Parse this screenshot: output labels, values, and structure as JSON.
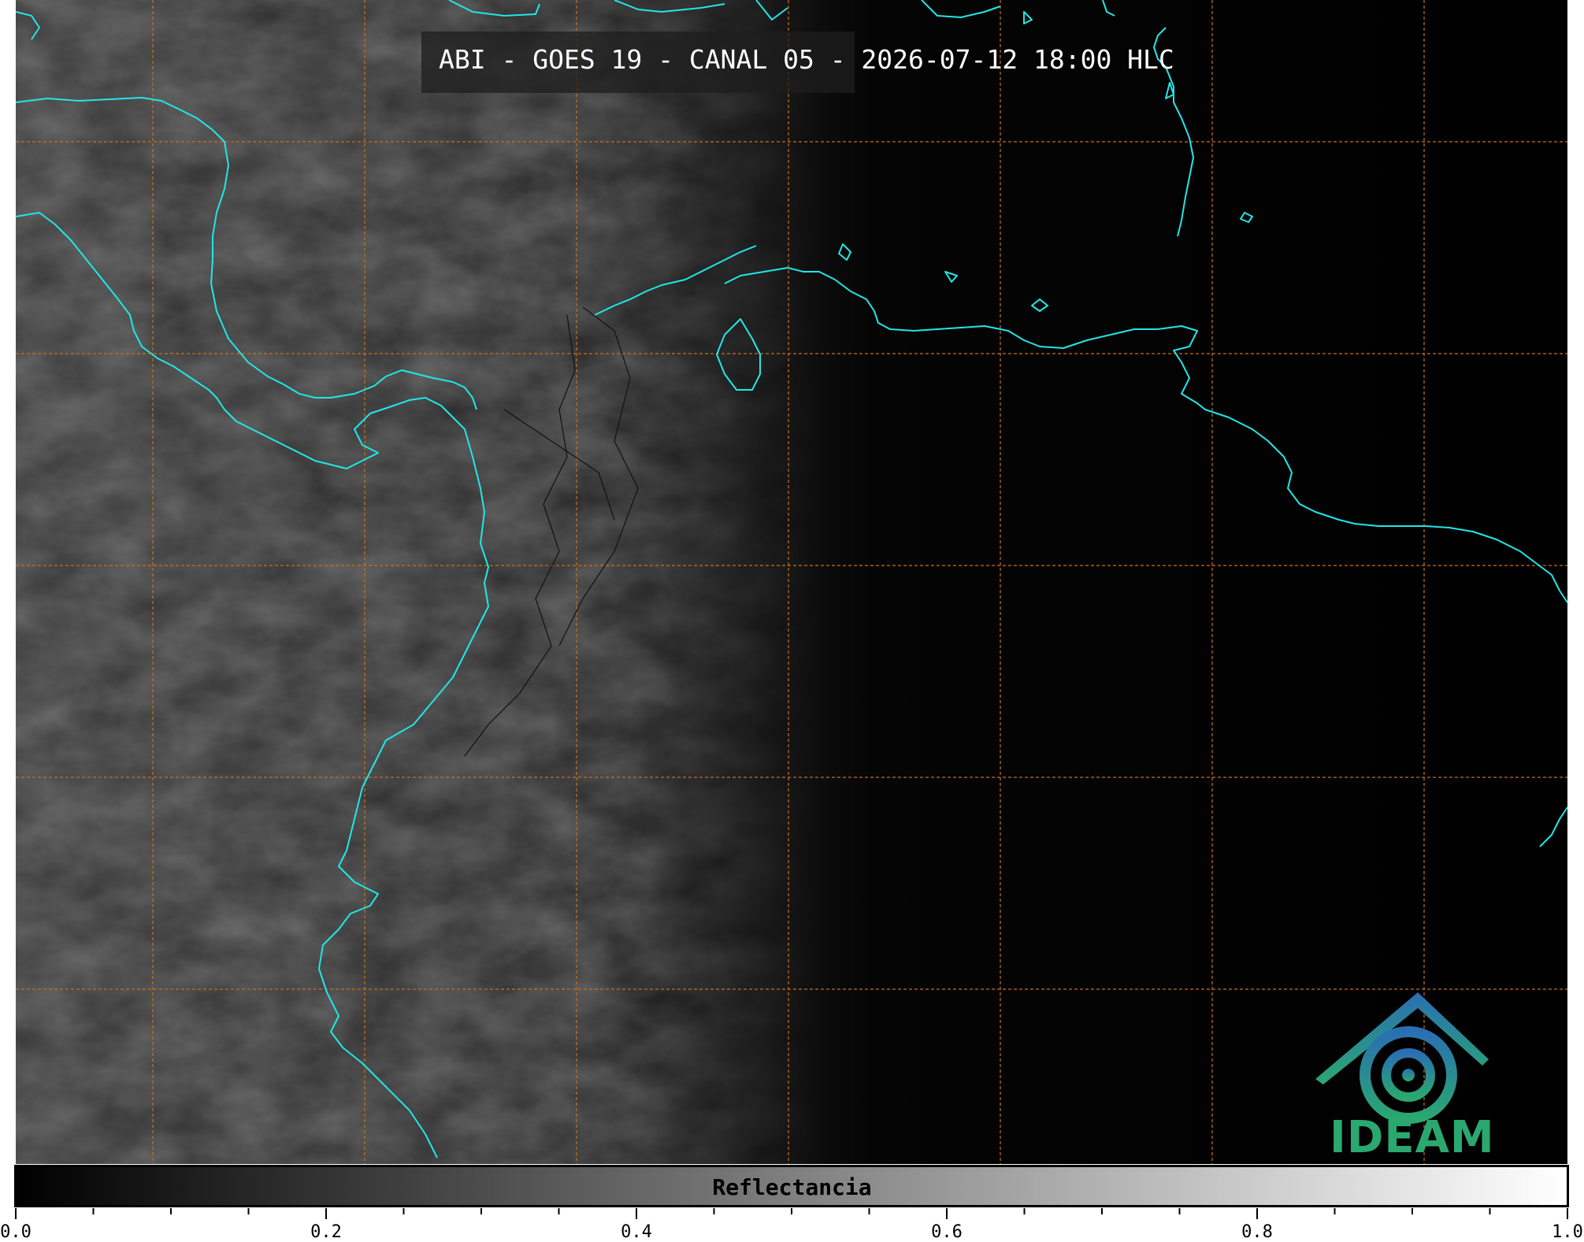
{
  "title": "ABI - GOES 19 - CANAL 05 - 2026-07-12 18:00 HLC",
  "colorbar": {
    "label": "Reflectancia",
    "ticks": [
      "0.0",
      "0.2",
      "0.4",
      "0.6",
      "0.8",
      "1.0"
    ],
    "range": [
      0.0,
      1.0
    ],
    "gradient_start": "#000000",
    "gradient_end": "#ffffff"
  },
  "logo": {
    "text": "IDEAM",
    "colors": [
      "#2a6fb3",
      "#2aa870"
    ]
  },
  "map": {
    "background": "#000000",
    "coastline_color": "#22e6e6",
    "gridline_color": "#c8701e",
    "border_color": "#111111"
  }
}
